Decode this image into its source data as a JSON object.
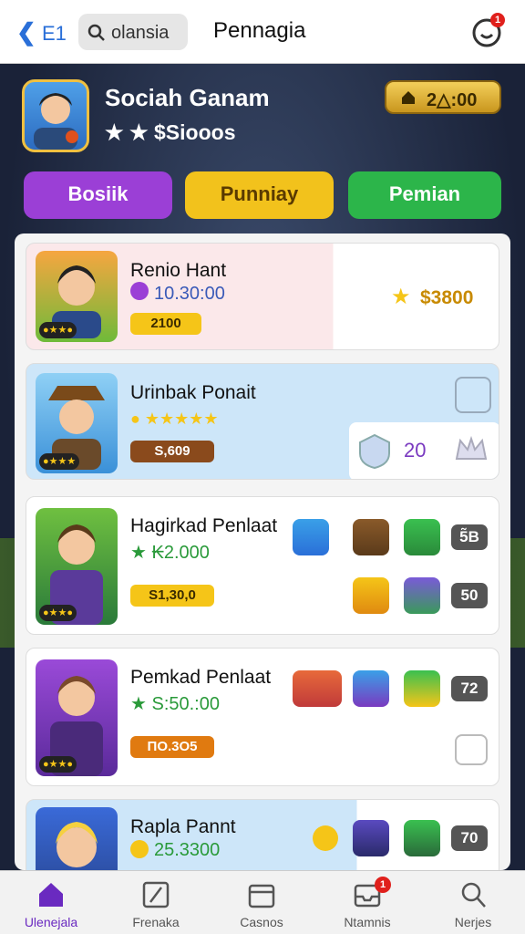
{
  "topbar": {
    "back_label": "E1",
    "search_text": "olansia",
    "title": "Pennagia",
    "notif_count": "1"
  },
  "profile": {
    "name": "Sociah Ganam",
    "score": "★ ★ $Siooos",
    "coins": "2△:00"
  },
  "tabs": [
    {
      "label": "Bosiik",
      "color": "#9b3fd6"
    },
    {
      "label": "Punniay",
      "color": "#f2c21c"
    },
    {
      "label": "Pemian",
      "color": "#2cb54a"
    }
  ],
  "cards": [
    {
      "name": "Renio Hant",
      "value": "10.30:00",
      "pill": "2100",
      "side": "$3800"
    },
    {
      "name": "Urinbak Ponait",
      "pill": "S,609",
      "count": "20"
    },
    {
      "name": "Hagirkad Penlaat",
      "value": "★ ₭2.000",
      "pill": "S1,30,0",
      "c1": "5̃B",
      "c2": "50"
    },
    {
      "name": "Pemkad Penlaat",
      "value": "★ S:50.:00",
      "pill": "ΠO.3O5",
      "c1": "72"
    },
    {
      "name": "Rapla Pannt",
      "value": "25.3300",
      "c1": "70"
    }
  ],
  "nav": [
    {
      "label": "Ulenejala"
    },
    {
      "label": "Frenaka"
    },
    {
      "label": "Casnos"
    },
    {
      "label": "Ntamnis"
    },
    {
      "label": "Nerjes"
    }
  ],
  "nav_badge": "1"
}
